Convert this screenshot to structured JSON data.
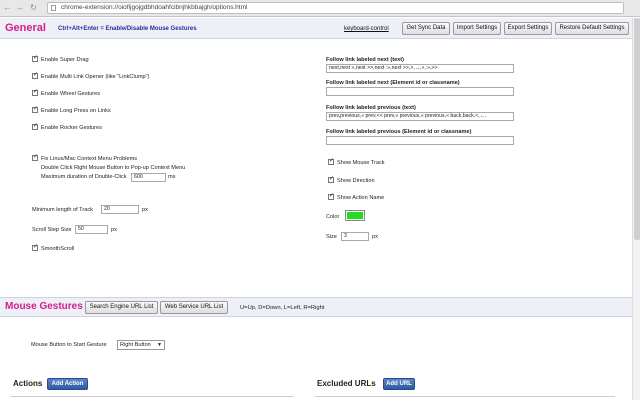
{
  "browser": {
    "url": "chrome-extension://oiofljgojgdbhdoahfcibnjhkbbajgh/options.html"
  },
  "general": {
    "title": "General",
    "hotkey": "Ctrl+Alt+Enter = Enable/Disable Mouse Gestures",
    "keyboard_control": "keyboard-control",
    "buttons": {
      "get_sync": "Get Sync Data",
      "import": "Import Settings",
      "export": "Export Settings",
      "restore": "Restore Default Settings"
    }
  },
  "options_left": {
    "super_drag": "Enable Super Drag",
    "multi_link": "Enable Multi Link Opener (like \"LinkClump\")",
    "wheel": "Enable Wheel Gestures",
    "long_press": "Enable Long Press on Links",
    "rocker": "Enable Rocker Gestures",
    "fix_linux": "Fix Linux/Mac Context Menu Problems",
    "fix_linux_hint": "Double Click Right Mouse Button to Pop-up Context Menu",
    "dbl_click_label": "Maximum duration of Double-Click",
    "dbl_click_value": "600",
    "dbl_click_unit": "ms",
    "min_track_label": "Minimum length of Track",
    "min_track_value": "20",
    "min_track_unit": "px",
    "scroll_step_label": "Scroll Step Size",
    "scroll_step_value": "50",
    "scroll_step_unit": "px",
    "smooth_scroll": "SmoothScroll"
  },
  "options_right": {
    "next_text_label": "Follow link labeled next (text)",
    "next_text_value": "next,next »,next >>,next :»,next >>,>,→,»,:»,>>",
    "next_id_label": "Follow link labeled next (Element id or classname)",
    "next_id_value": "",
    "prev_text_label": "Follow link labeled previous (text)",
    "prev_text_value": "prev,previous,« prev,<< prev,« previous,« previous,« back,back,<,←,",
    "prev_id_label": "Follow link labeled previous (Element id or classname)",
    "prev_id_value": "",
    "show_track": "Show Mouse Track",
    "show_direction": "Show Direction",
    "show_action": "Show Action Name",
    "color_label": "Color",
    "color_value": "#22dd22",
    "size_label": "Size",
    "size_value": "3",
    "size_unit": "px"
  },
  "mouse_gestures": {
    "title": "Mouse Gestures",
    "search_engine_btn": "Search Engine URL List",
    "web_service_btn": "Web Service URL List",
    "legend": "U=Up, D=Down, L=Left, R=Right",
    "start_button_label": "Mouse Button to Start Gesture",
    "start_button_value": "Right Button"
  },
  "actions": {
    "title": "Actions",
    "add_btn": "Add Action"
  },
  "excluded": {
    "title": "Excluded URLs",
    "add_btn": "Add URL"
  },
  "colors": {
    "accent": "#d61c8c",
    "hint_red": "#d01010",
    "button_blue": "#2f5aa3"
  }
}
